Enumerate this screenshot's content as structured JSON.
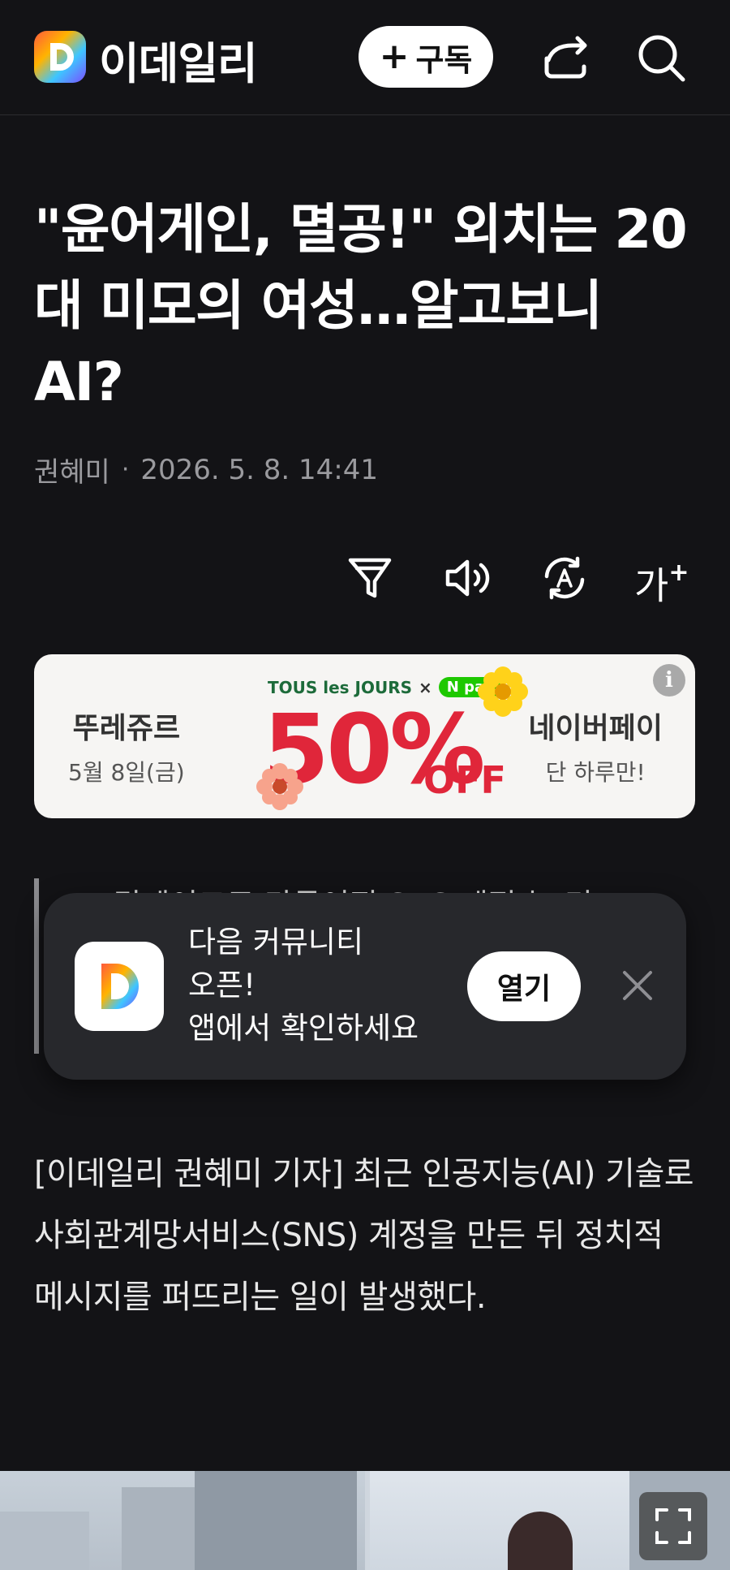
{
  "header": {
    "brand": "이데일리",
    "logo_letter": "D",
    "subscribe_label": "구독",
    "icons": [
      "share-icon",
      "search-icon"
    ]
  },
  "article": {
    "title": "\"윤어게인, 멸공!\" 외치는 20대 미모의 여성…알고보니 AI?",
    "author": "권혜미",
    "datetime": "2026. 5. 8. 14:41",
    "tools": [
      "filter-icon",
      "audio-icon",
      "translate-icon",
      "font-size-icon"
    ],
    "font_size_label": "가",
    "quote_partial": "AI 딥페이크로 만들어진 SNS 계정 늘 리",
    "body": "[이데일리 권혜미 기자] 최근 인공지능(AI) 기술로 사회관계망서비스(SNS) 계정을 만든 뒤 정치적 메시지를 퍼뜨리는 일이 발생했다."
  },
  "ad": {
    "left_title": "뚜레쥬르",
    "left_sub": "5월 8일(금)",
    "brand1": "TOUS les JOURS",
    "brand_x": "×",
    "brand2": "pay",
    "discount": "50%",
    "off": "OFF",
    "right_title": "네이버페이",
    "right_sub": "단 하루만!",
    "info": "i"
  },
  "toast": {
    "line1": "다음 커뮤니티",
    "line2": "오픈!",
    "line3": "앱에서 확인하세요",
    "open_label": "열기"
  },
  "colors": {
    "background": "#131316",
    "ad_red": "#e0263a",
    "toast_bg": "#27282c"
  }
}
